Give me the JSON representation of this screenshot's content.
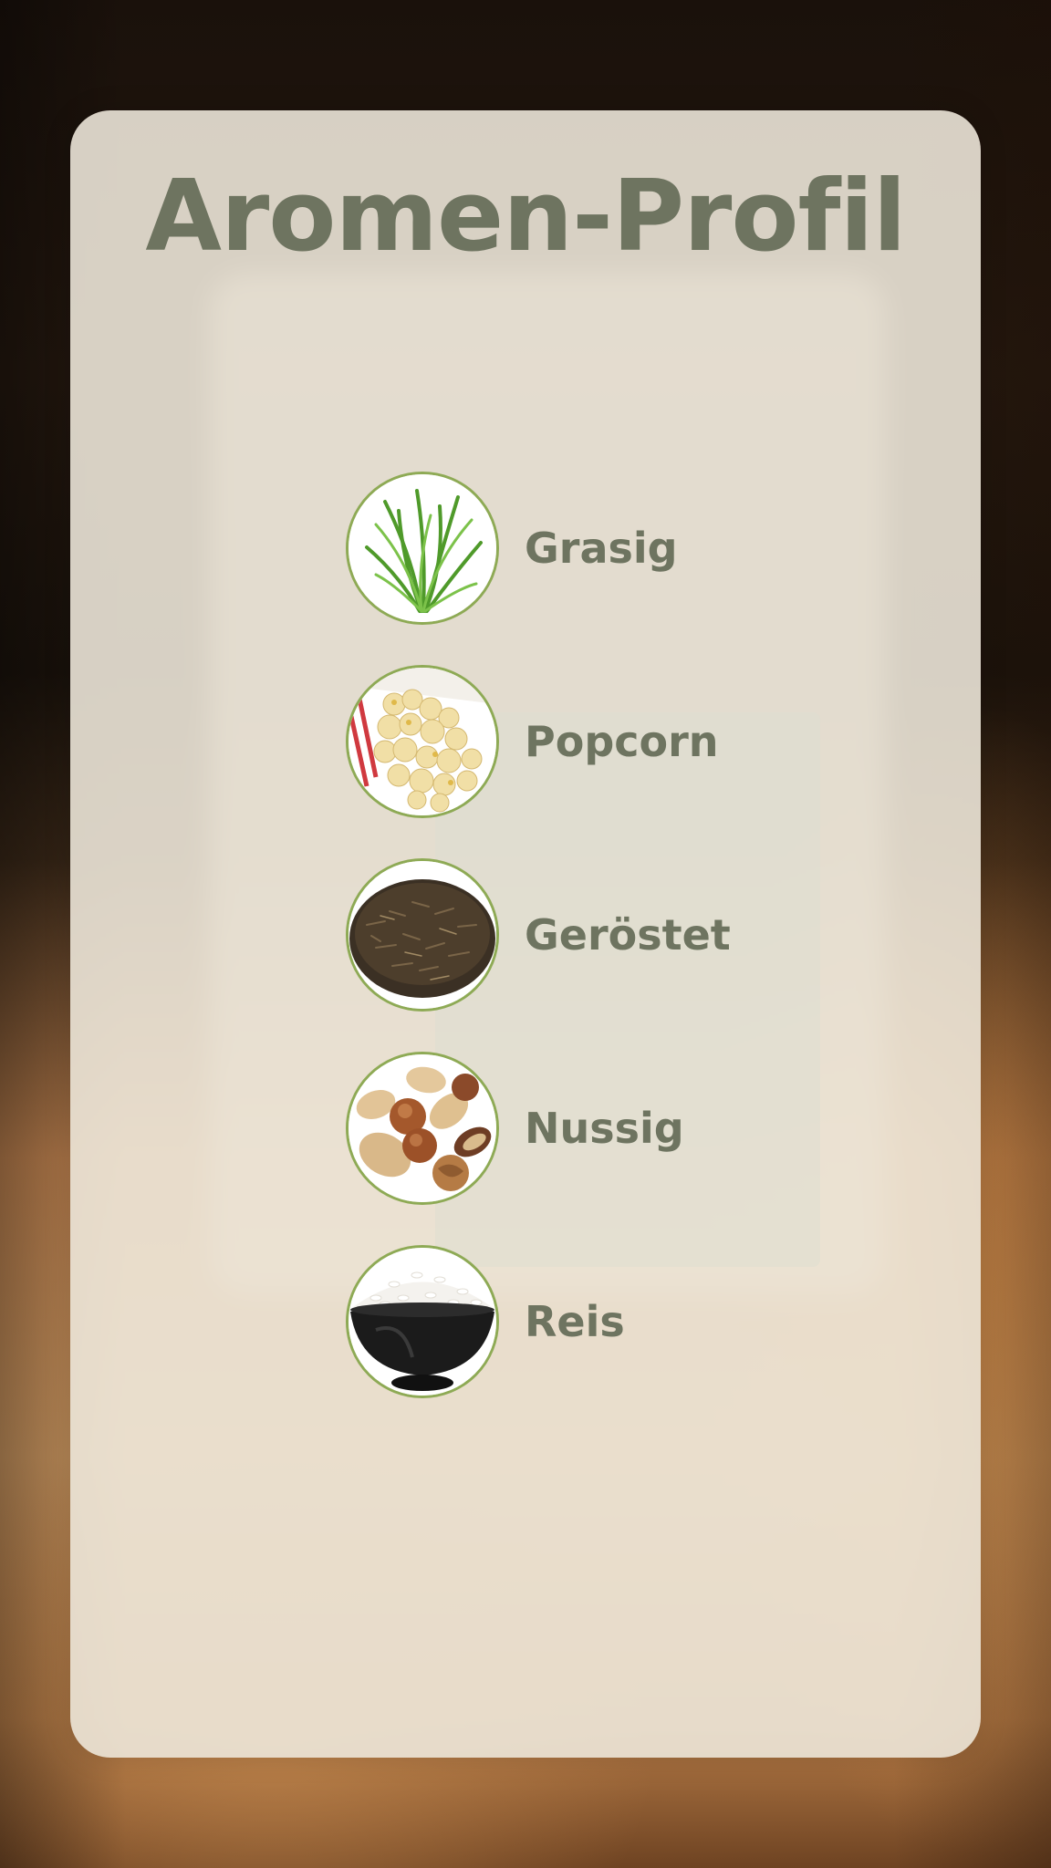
{
  "title": "Aromen-Profil",
  "flavors": [
    {
      "label": "Grasig",
      "icon": "grass-icon"
    },
    {
      "label": "Popcorn",
      "icon": "popcorn-icon"
    },
    {
      "label": "Geröstet",
      "icon": "roasted-tea-leaves-icon"
    },
    {
      "label": "Nussig",
      "icon": "nuts-icon"
    },
    {
      "label": "Reis",
      "icon": "rice-bowl-icon"
    }
  ],
  "colors": {
    "accent_text": "#6e7460",
    "icon_border": "#8eaa55",
    "card_background": "#ece6d8"
  }
}
